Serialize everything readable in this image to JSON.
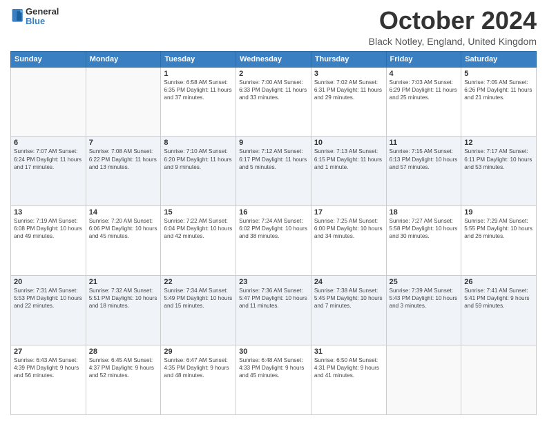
{
  "header": {
    "logo_general": "General",
    "logo_blue": "Blue",
    "month_title": "October 2024",
    "subtitle": "Black Notley, England, United Kingdom"
  },
  "weekdays": [
    "Sunday",
    "Monday",
    "Tuesday",
    "Wednesday",
    "Thursday",
    "Friday",
    "Saturday"
  ],
  "weeks": [
    [
      {
        "day": "",
        "info": ""
      },
      {
        "day": "",
        "info": ""
      },
      {
        "day": "1",
        "info": "Sunrise: 6:58 AM\nSunset: 6:35 PM\nDaylight: 11 hours and 37 minutes."
      },
      {
        "day": "2",
        "info": "Sunrise: 7:00 AM\nSunset: 6:33 PM\nDaylight: 11 hours and 33 minutes."
      },
      {
        "day": "3",
        "info": "Sunrise: 7:02 AM\nSunset: 6:31 PM\nDaylight: 11 hours and 29 minutes."
      },
      {
        "day": "4",
        "info": "Sunrise: 7:03 AM\nSunset: 6:29 PM\nDaylight: 11 hours and 25 minutes."
      },
      {
        "day": "5",
        "info": "Sunrise: 7:05 AM\nSunset: 6:26 PM\nDaylight: 11 hours and 21 minutes."
      }
    ],
    [
      {
        "day": "6",
        "info": "Sunrise: 7:07 AM\nSunset: 6:24 PM\nDaylight: 11 hours and 17 minutes."
      },
      {
        "day": "7",
        "info": "Sunrise: 7:08 AM\nSunset: 6:22 PM\nDaylight: 11 hours and 13 minutes."
      },
      {
        "day": "8",
        "info": "Sunrise: 7:10 AM\nSunset: 6:20 PM\nDaylight: 11 hours and 9 minutes."
      },
      {
        "day": "9",
        "info": "Sunrise: 7:12 AM\nSunset: 6:17 PM\nDaylight: 11 hours and 5 minutes."
      },
      {
        "day": "10",
        "info": "Sunrise: 7:13 AM\nSunset: 6:15 PM\nDaylight: 11 hours and 1 minute."
      },
      {
        "day": "11",
        "info": "Sunrise: 7:15 AM\nSunset: 6:13 PM\nDaylight: 10 hours and 57 minutes."
      },
      {
        "day": "12",
        "info": "Sunrise: 7:17 AM\nSunset: 6:11 PM\nDaylight: 10 hours and 53 minutes."
      }
    ],
    [
      {
        "day": "13",
        "info": "Sunrise: 7:19 AM\nSunset: 6:08 PM\nDaylight: 10 hours and 49 minutes."
      },
      {
        "day": "14",
        "info": "Sunrise: 7:20 AM\nSunset: 6:06 PM\nDaylight: 10 hours and 45 minutes."
      },
      {
        "day": "15",
        "info": "Sunrise: 7:22 AM\nSunset: 6:04 PM\nDaylight: 10 hours and 42 minutes."
      },
      {
        "day": "16",
        "info": "Sunrise: 7:24 AM\nSunset: 6:02 PM\nDaylight: 10 hours and 38 minutes."
      },
      {
        "day": "17",
        "info": "Sunrise: 7:25 AM\nSunset: 6:00 PM\nDaylight: 10 hours and 34 minutes."
      },
      {
        "day": "18",
        "info": "Sunrise: 7:27 AM\nSunset: 5:58 PM\nDaylight: 10 hours and 30 minutes."
      },
      {
        "day": "19",
        "info": "Sunrise: 7:29 AM\nSunset: 5:55 PM\nDaylight: 10 hours and 26 minutes."
      }
    ],
    [
      {
        "day": "20",
        "info": "Sunrise: 7:31 AM\nSunset: 5:53 PM\nDaylight: 10 hours and 22 minutes."
      },
      {
        "day": "21",
        "info": "Sunrise: 7:32 AM\nSunset: 5:51 PM\nDaylight: 10 hours and 18 minutes."
      },
      {
        "day": "22",
        "info": "Sunrise: 7:34 AM\nSunset: 5:49 PM\nDaylight: 10 hours and 15 minutes."
      },
      {
        "day": "23",
        "info": "Sunrise: 7:36 AM\nSunset: 5:47 PM\nDaylight: 10 hours and 11 minutes."
      },
      {
        "day": "24",
        "info": "Sunrise: 7:38 AM\nSunset: 5:45 PM\nDaylight: 10 hours and 7 minutes."
      },
      {
        "day": "25",
        "info": "Sunrise: 7:39 AM\nSunset: 5:43 PM\nDaylight: 10 hours and 3 minutes."
      },
      {
        "day": "26",
        "info": "Sunrise: 7:41 AM\nSunset: 5:41 PM\nDaylight: 9 hours and 59 minutes."
      }
    ],
    [
      {
        "day": "27",
        "info": "Sunrise: 6:43 AM\nSunset: 4:39 PM\nDaylight: 9 hours and 56 minutes."
      },
      {
        "day": "28",
        "info": "Sunrise: 6:45 AM\nSunset: 4:37 PM\nDaylight: 9 hours and 52 minutes."
      },
      {
        "day": "29",
        "info": "Sunrise: 6:47 AM\nSunset: 4:35 PM\nDaylight: 9 hours and 48 minutes."
      },
      {
        "day": "30",
        "info": "Sunrise: 6:48 AM\nSunset: 4:33 PM\nDaylight: 9 hours and 45 minutes."
      },
      {
        "day": "31",
        "info": "Sunrise: 6:50 AM\nSunset: 4:31 PM\nDaylight: 9 hours and 41 minutes."
      },
      {
        "day": "",
        "info": ""
      },
      {
        "day": "",
        "info": ""
      }
    ]
  ]
}
